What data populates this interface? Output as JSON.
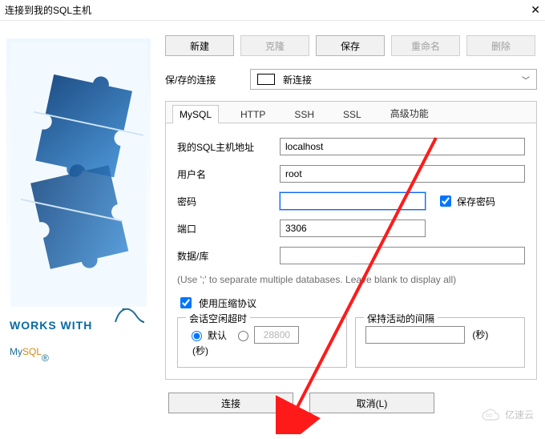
{
  "window_title": "连接到我的SQL主机",
  "top_buttons": {
    "new": {
      "label": "新建",
      "enabled": true
    },
    "clone": {
      "label": "克隆",
      "enabled": false
    },
    "save": {
      "label": "保存",
      "enabled": true
    },
    "rename": {
      "label": "重命名",
      "enabled": false
    },
    "delete": {
      "label": "删除",
      "enabled": false
    }
  },
  "saved_connections": {
    "label": "保/存的连接",
    "selected": "新连接"
  },
  "tabs": {
    "mysql": "MySQL",
    "http": "HTTP",
    "ssh": "SSH",
    "ssl": "SSL",
    "adv": "高级功能",
    "active": "mysql"
  },
  "form": {
    "host_label": "我的SQL主机地址",
    "host_value": "localhost",
    "user_label": "用户名",
    "user_value": "root",
    "pwd_label": "密码",
    "pwd_value": "",
    "save_pwd_label": "保存密码",
    "save_pwd_checked": true,
    "port_label": "端口",
    "port_value": "3306",
    "db_label": "数据/库",
    "db_value": "",
    "db_hint": "(Use ';' to separate multiple databases. Leave blank to display all)",
    "compress_label": "使用压缩协议",
    "compress_checked": true
  },
  "session_idle": {
    "legend": "会话空闲超时",
    "default_label": "默认",
    "default_selected": true,
    "custom_value": "28800",
    "seconds_label": "(秒)"
  },
  "keep_alive": {
    "legend": "保持活动的间隔",
    "value": "",
    "seconds_label": "(秒)"
  },
  "footer": {
    "connect": "连接",
    "cancel": "取消(L)"
  },
  "sidebar": {
    "works_with": "WORKS WITH",
    "logo_text_my": "My",
    "logo_text_sql": "SQL",
    "logo_reg": "®"
  },
  "watermark": "亿速云"
}
